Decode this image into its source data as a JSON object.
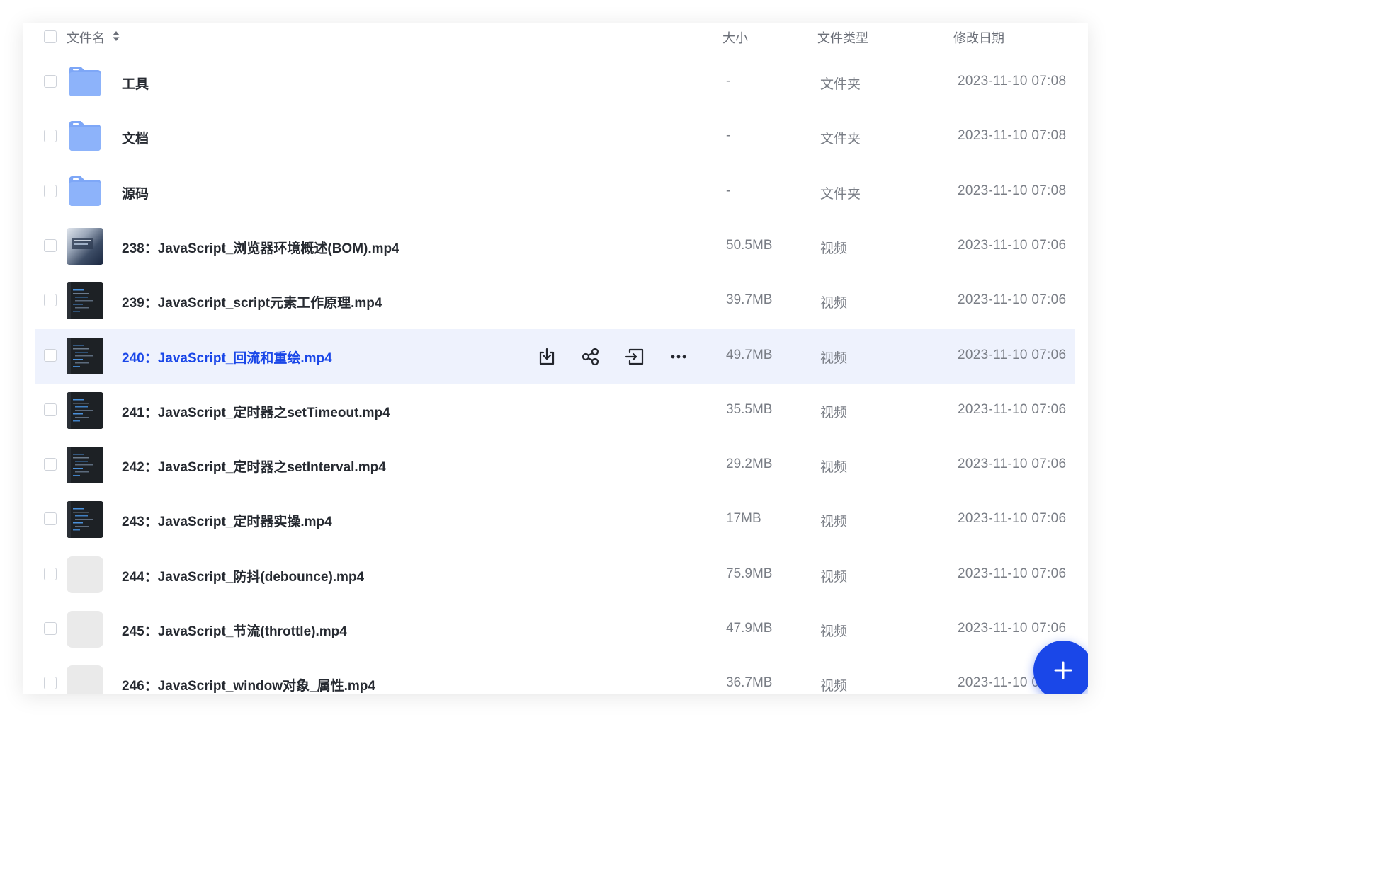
{
  "header": {
    "name_label": "文件名",
    "size_label": "大小",
    "type_label": "文件类型",
    "date_label": "修改日期"
  },
  "files": [
    {
      "name": "工具",
      "size": "-",
      "type": "文件夹",
      "date": "2023-11-10 07:08",
      "thumb": "folder"
    },
    {
      "name": "文档",
      "size": "-",
      "type": "文件夹",
      "date": "2023-11-10 07:08",
      "thumb": "folder"
    },
    {
      "name": "源码",
      "size": "-",
      "type": "文件夹",
      "date": "2023-11-10 07:08",
      "thumb": "folder"
    },
    {
      "name": "238：JavaScript_浏览器环境概述(BOM).mp4",
      "size": "50.5MB",
      "type": "视频",
      "date": "2023-11-10 07:06",
      "thumb": "video-blur"
    },
    {
      "name": "239：JavaScript_script元素工作原理.mp4",
      "size": "39.7MB",
      "type": "视频",
      "date": "2023-11-10 07:06",
      "thumb": "video-dark"
    },
    {
      "name": "240：JavaScript_回流和重绘.mp4",
      "size": "49.7MB",
      "type": "视频",
      "date": "2023-11-10 07:06",
      "thumb": "video-dark"
    },
    {
      "name": "241：JavaScript_定时器之setTimeout.mp4",
      "size": "35.5MB",
      "type": "视频",
      "date": "2023-11-10 07:06",
      "thumb": "video-dark"
    },
    {
      "name": "242：JavaScript_定时器之setInterval.mp4",
      "size": "29.2MB",
      "type": "视频",
      "date": "2023-11-10 07:06",
      "thumb": "video-dark"
    },
    {
      "name": "243：JavaScript_定时器实操.mp4",
      "size": "17MB",
      "type": "视频",
      "date": "2023-11-10 07:06",
      "thumb": "video-dark"
    },
    {
      "name": "244：JavaScript_防抖(debounce).mp4",
      "size": "75.9MB",
      "type": "视频",
      "date": "2023-11-10 07:06",
      "thumb": "placeholder"
    },
    {
      "name": "245：JavaScript_节流(throttle).mp4",
      "size": "47.9MB",
      "type": "视频",
      "date": "2023-11-10 07:06",
      "thumb": "placeholder"
    },
    {
      "name": "246：JavaScript_window对象_属性.mp4",
      "size": "36.7MB",
      "type": "视频",
      "date": "2023-11-10 07:06",
      "thumb": "placeholder"
    }
  ],
  "highlighted_index": 5,
  "row_actions": [
    "download-icon",
    "share-icon",
    "move-icon",
    "more-icon"
  ],
  "fab": {
    "icon": "plus-icon"
  },
  "colors": {
    "accent": "#1a47e8",
    "highlight_bg": "#eef2fd",
    "folder": "#7ea7f7",
    "text_primary": "#262a31",
    "text_secondary": "#7a7e86"
  }
}
